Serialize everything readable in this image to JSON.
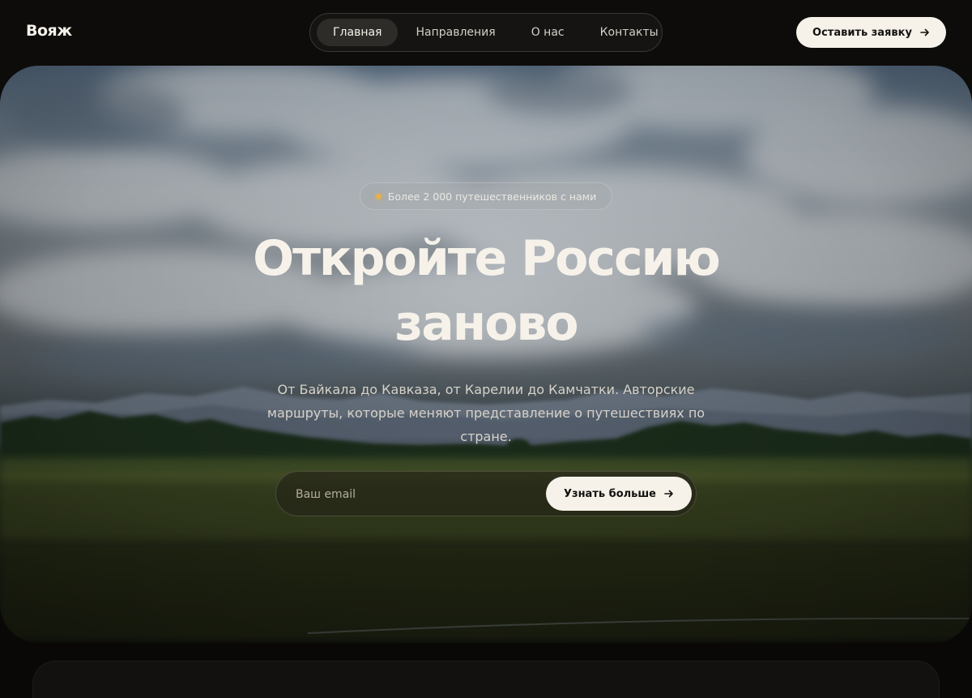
{
  "brand": {
    "logo_text": "Вояж"
  },
  "nav": {
    "items": [
      {
        "label": "Главная",
        "active": true
      },
      {
        "label": "Направления",
        "active": false
      },
      {
        "label": "О нас",
        "active": false
      },
      {
        "label": "Контакты",
        "active": false
      }
    ]
  },
  "header": {
    "cta_label": "Оставить заявку"
  },
  "hero": {
    "badge_text": "Более 2 000 путешественников с нами",
    "title_line1": "Откройте Россию",
    "title_line2": "заново",
    "subtitle": "От Байкала до Кавказа, от Карелии до Камчатки. Авторские маршруты, которые меняют представление о путешествиях по стране.",
    "email_placeholder": "Ваш email",
    "submit_label": "Узнать больше"
  },
  "colors": {
    "accent_light": "#f6f2ea",
    "badge_dot": "#e7b04a",
    "background": "#0a0908"
  },
  "icons": {
    "cta_arrow": "arrow-right-icon",
    "submit_arrow": "arrow-right-icon",
    "badge_dot": "status-dot-icon"
  }
}
